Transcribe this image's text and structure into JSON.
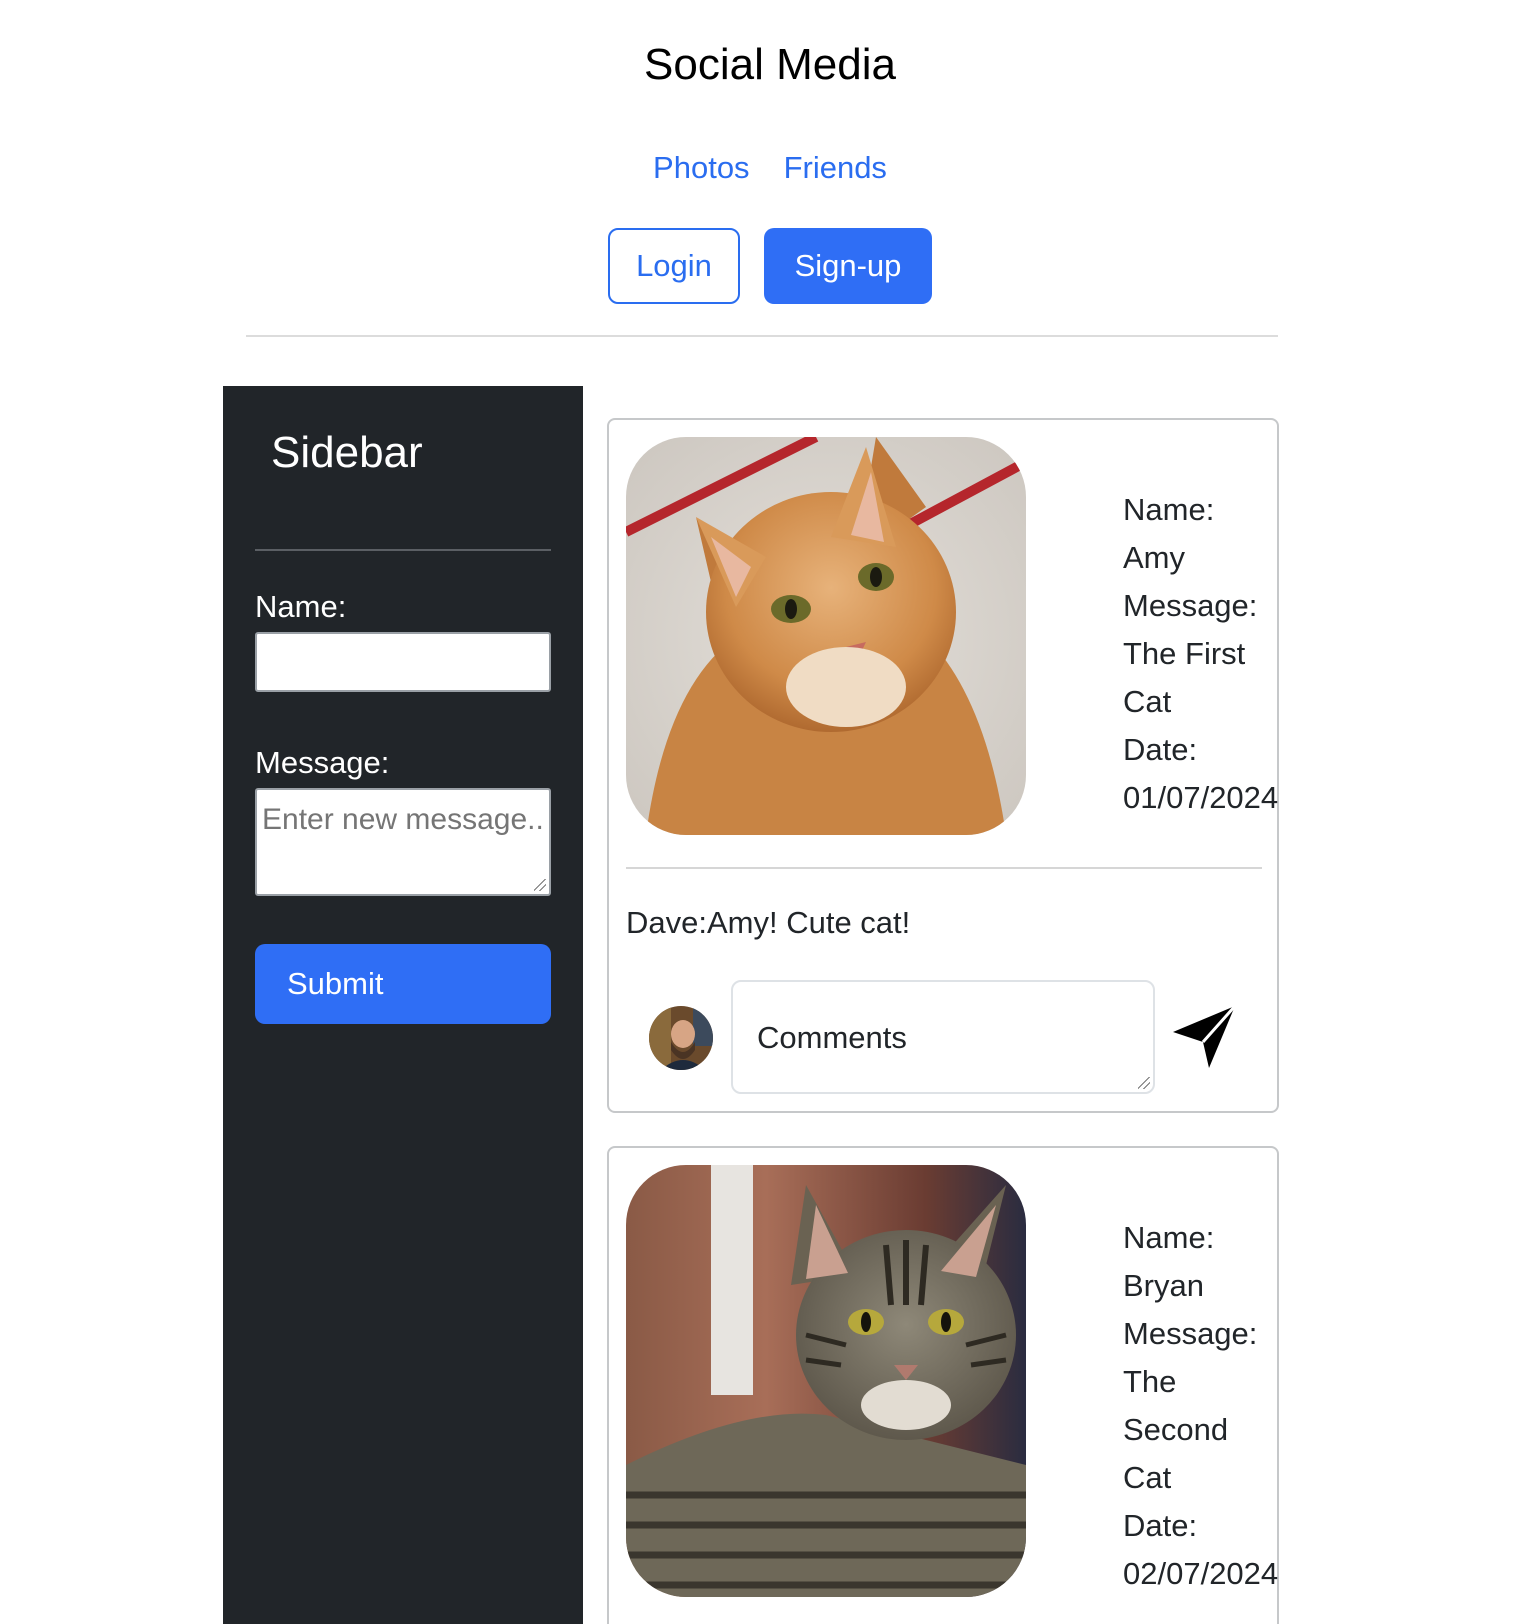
{
  "header": {
    "title": "Social Media",
    "nav": [
      {
        "label": "Photos"
      },
      {
        "label": "Friends"
      }
    ],
    "login_label": "Login",
    "signup_label": "Sign-up"
  },
  "sidebar": {
    "title": "Sidebar",
    "name_label": "Name:",
    "name_value": "",
    "message_label": "Message:",
    "message_placeholder": "Enter new message..",
    "submit_label": "Submit"
  },
  "posts": [
    {
      "image_icon": "orange-cat-photo",
      "info_lines": [
        "Name:",
        "Amy",
        "Message:",
        "The First",
        "Cat",
        "Date:",
        "01/07/2024"
      ],
      "comment": "Dave:Amy! Cute cat!",
      "comment_placeholder": "Comments"
    },
    {
      "image_icon": "tabby-cat-photo",
      "info_lines": [
        "Name:",
        "Bryan",
        "Message:",
        "The",
        "Second",
        "Cat",
        "Date:",
        "02/07/2024"
      ]
    }
  ],
  "colors": {
    "accent": "#2f6ef5",
    "sidebar_bg": "#212529",
    "link": "#2a6df0"
  }
}
